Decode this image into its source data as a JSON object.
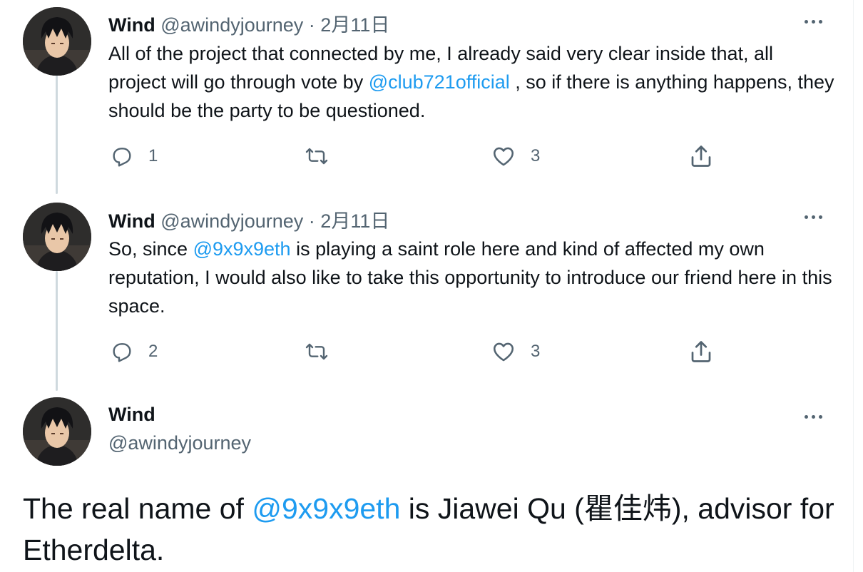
{
  "colors": {
    "link": "#1d9bf0",
    "secondary": "#536471",
    "text": "#0f1419",
    "thread_line": "#cfd9de"
  },
  "tweets": [
    {
      "name": "Wind",
      "handle": "@awindyjourney",
      "separator": "·",
      "date": "2月11日",
      "text_parts": [
        "All of the project that connected by me, I already said very clear inside that, all project will go through vote by ",
        "@club721official",
        " , so if there is anything happens, they should be the party to be questioned."
      ],
      "reply_count": "1",
      "retweet_count": "",
      "like_count": "3"
    },
    {
      "name": "Wind",
      "handle": "@awindyjourney",
      "separator": "·",
      "date": "2月11日",
      "text_parts": [
        "So, since ",
        "@9x9x9eth",
        " is playing a saint role here and kind of affected my own reputation, I would also like to take this opportunity to introduce our friend here in this space."
      ],
      "reply_count": "2",
      "retweet_count": "",
      "like_count": "3"
    }
  ],
  "main_tweet": {
    "name": "Wind",
    "handle": "@awindyjourney",
    "text_parts": [
      "The real name of ",
      "@9x9x9eth",
      " is Jiawei Qu (瞿佳炜), advisor for Etherdelta."
    ]
  },
  "icons": {
    "reply": "reply-icon",
    "retweet": "retweet-icon",
    "like": "like-icon",
    "share": "share-icon",
    "more": "more-icon"
  }
}
